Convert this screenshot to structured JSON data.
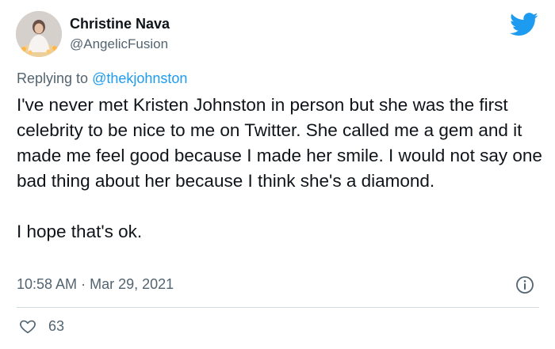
{
  "author": {
    "display_name": "Christine Nava",
    "handle": "@AngelicFusion",
    "avatar_icon": "profile-photo"
  },
  "reply": {
    "prefix": "Replying to",
    "mention": "@thekjohnston"
  },
  "tweet": {
    "paragraphs": [
      "I've never met Kristen Johnston in person but she was the first celebrity to be nice to me on Twitter. She called me a gem and it made me feel good because I made her smile. I would not say one bad thing about her because I think she's a diamond.",
      "I hope that's ok."
    ],
    "time": "10:58 AM",
    "separator": "·",
    "date": "Mar 29, 2021"
  },
  "engagement": {
    "likes": "63",
    "like_icon": "heart-icon"
  },
  "icons": {
    "brand": "twitter-bird-icon",
    "info": "info-icon"
  },
  "colors": {
    "brand_blue": "#1d9bf0",
    "text_primary": "#0f1419",
    "text_secondary": "#536471",
    "divider": "#cfd9de"
  }
}
